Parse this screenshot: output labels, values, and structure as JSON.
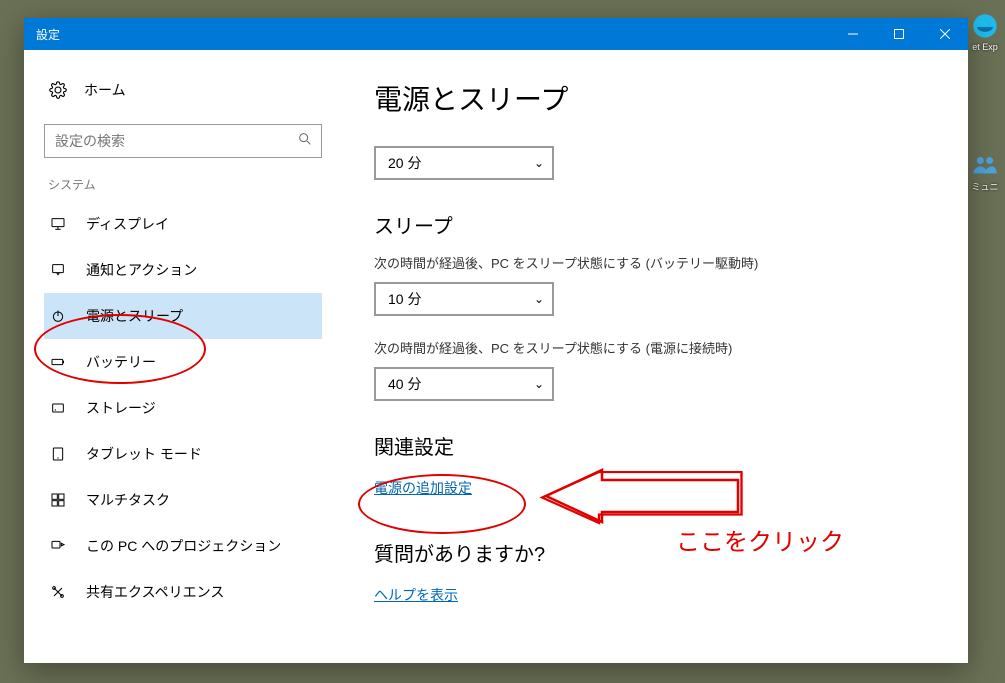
{
  "window": {
    "title": "設定"
  },
  "sidebar": {
    "home": "ホーム",
    "search_placeholder": "設定の検索",
    "section": "システム",
    "items": [
      {
        "label": "ディスプレイ",
        "icon": "display-icon",
        "active": false
      },
      {
        "label": "通知とアクション",
        "icon": "notifications-icon",
        "active": false
      },
      {
        "label": "電源とスリープ",
        "icon": "power-icon",
        "active": true
      },
      {
        "label": "バッテリー",
        "icon": "battery-icon",
        "active": false
      },
      {
        "label": "ストレージ",
        "icon": "storage-icon",
        "active": false
      },
      {
        "label": "タブレット モード",
        "icon": "tablet-icon",
        "active": false
      },
      {
        "label": "マルチタスク",
        "icon": "multitask-icon",
        "active": false
      },
      {
        "label": "この PC へのプロジェクション",
        "icon": "projection-icon",
        "active": false
      },
      {
        "label": "共有エクスペリエンス",
        "icon": "shared-icon",
        "active": false
      }
    ]
  },
  "main": {
    "title": "電源とスリープ",
    "dropdown1_value": "20 分",
    "section_sleep": "スリープ",
    "sleep_battery_label": "次の時間が経過後、PC をスリープ状態にする (バッテリー駆動時)",
    "sleep_battery_value": "10 分",
    "sleep_plugged_label": "次の時間が経過後、PC をスリープ状態にする (電源に接続時)",
    "sleep_plugged_value": "40 分",
    "section_related": "関連設定",
    "link_power": "電源の追加設定",
    "section_question": "質問がありますか?",
    "link_help": "ヘルプを表示"
  },
  "annotation": {
    "hint": "ここをクリック"
  },
  "desktop": {
    "ie": "et Exp",
    "comm": "ミュニ"
  }
}
